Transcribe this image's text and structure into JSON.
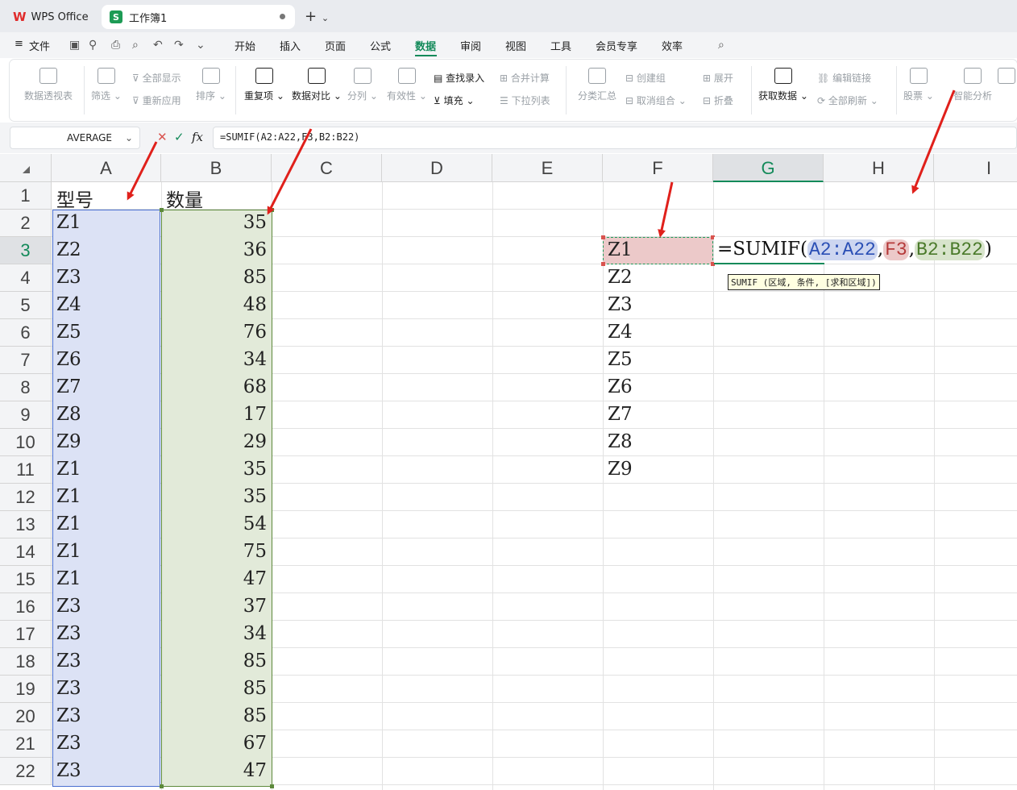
{
  "tabs": {
    "wps": "WPS Office",
    "workbook": "工作簿1",
    "sheet_logo": "S",
    "new_tab": "+"
  },
  "menu": {
    "file": "文件",
    "items": [
      "开始",
      "插入",
      "页面",
      "公式",
      "数据",
      "审阅",
      "视图",
      "工具",
      "会员专享",
      "效率"
    ],
    "active": "数据"
  },
  "ribbon": {
    "pivot": "数据透视表",
    "filter": "筛选",
    "show_all": "全部显示",
    "reapply": "重新应用",
    "sort": "排序",
    "duplicates": "重复项",
    "compare": "数据对比",
    "split": "分列",
    "validity": "有效性",
    "find_input": "查找录入",
    "fill": "填充",
    "merge_calc": "合并计算",
    "dropdown_list": "下拉列表",
    "subtotal": "分类汇总",
    "create_group": "创建组",
    "ungroup": "取消组合",
    "expand": "展开",
    "collapse": "折叠",
    "get_data": "获取数据",
    "edit_links": "编辑链接",
    "refresh_all": "全部刷新",
    "stocks": "股票",
    "smart_analysis": "智能分析"
  },
  "formula_bar": {
    "name_box": "AVERAGE",
    "cancel": "✕",
    "confirm": "✓",
    "fx": "fx",
    "formula": "=SUMIF(A2:A22,F3,B2:B22)"
  },
  "columns": [
    "A",
    "B",
    "C",
    "D",
    "E",
    "F",
    "G",
    "H",
    "I"
  ],
  "selected_column": "G",
  "selected_row": "3",
  "rows": [
    "1",
    "2",
    "3",
    "4",
    "5",
    "6",
    "7",
    "8",
    "9",
    "10",
    "11",
    "12",
    "13",
    "14",
    "15",
    "16",
    "17",
    "18",
    "19",
    "20",
    "21",
    "22"
  ],
  "header": {
    "model": "型号",
    "quantity": "数量"
  },
  "col_a": [
    "Z1",
    "Z2",
    "Z3",
    "Z4",
    "Z5",
    "Z6",
    "Z7",
    "Z8",
    "Z9",
    "Z1",
    "Z1",
    "Z1",
    "Z1",
    "Z1",
    "Z3",
    "Z3",
    "Z3",
    "Z3",
    "Z3",
    "Z3",
    "Z3"
  ],
  "col_b": [
    "35",
    "36",
    "85",
    "48",
    "76",
    "34",
    "68",
    "17",
    "29",
    "35",
    "35",
    "54",
    "75",
    "47",
    "37",
    "34",
    "85",
    "85",
    "85",
    "67",
    "47"
  ],
  "col_f": [
    "Z1",
    "Z2",
    "Z3",
    "Z4",
    "Z5",
    "Z6",
    "Z7",
    "Z8",
    "Z9"
  ],
  "editing": {
    "prefix": "=SUMIF(",
    "arg1": "A2:A22",
    "comma": ",",
    "arg2": "F3",
    "arg3": "B2:B22",
    "suffix": ")",
    "tooltip": "SUMIF (区域, 条件, [求和区域])"
  },
  "colors": {
    "accent": "#148a5a",
    "range_a": "#dce2f5",
    "range_b": "#e2ead9",
    "range_f3": "#ecc9c9",
    "arrow": "#e0201b"
  }
}
